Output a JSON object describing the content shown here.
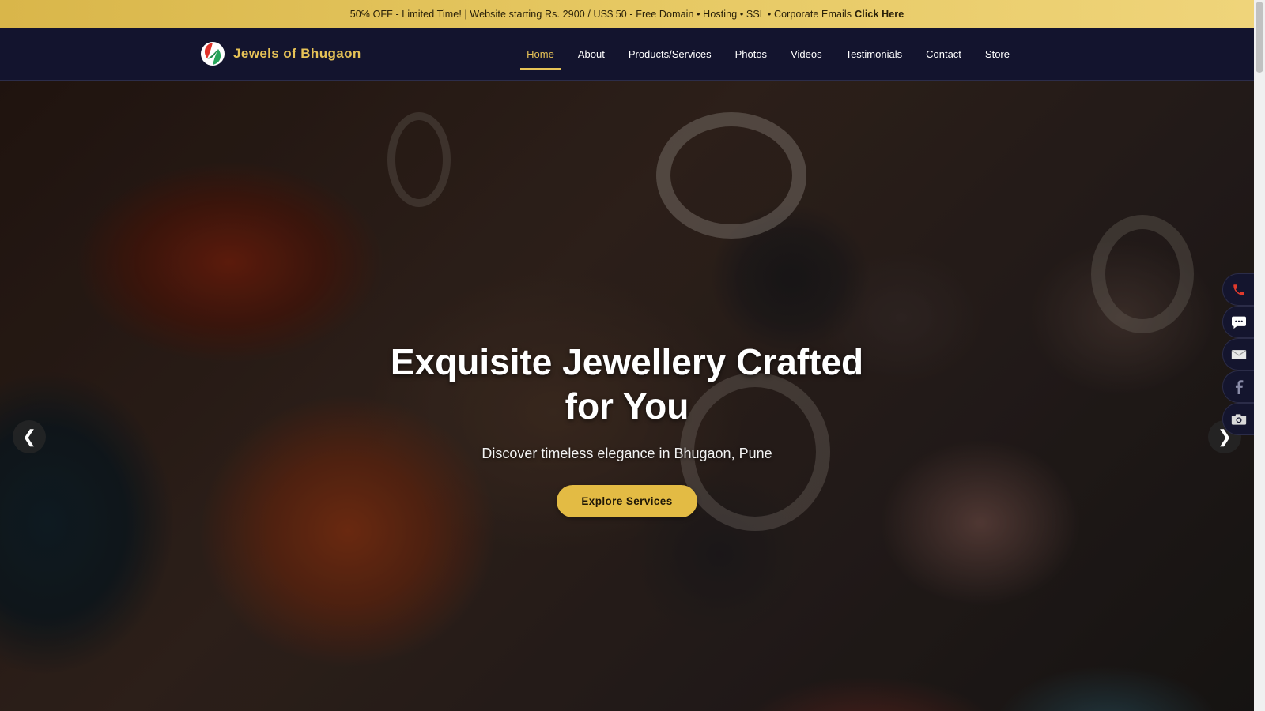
{
  "promo": {
    "text": "50% OFF - Limited Time! | Website starting Rs. 2900 / US$ 50 - Free Domain • Hosting • SSL • Corporate Emails",
    "cta": "Click Here"
  },
  "brand": {
    "name": "Jewels of Bhugaon",
    "logo_icon": "leaf-logo-icon"
  },
  "nav": {
    "items": [
      {
        "label": "Home",
        "active": true
      },
      {
        "label": "About",
        "active": false
      },
      {
        "label": "Products/Services",
        "active": false
      },
      {
        "label": "Photos",
        "active": false
      },
      {
        "label": "Videos",
        "active": false
      },
      {
        "label": "Testimonials",
        "active": false
      },
      {
        "label": "Contact",
        "active": false
      },
      {
        "label": "Store",
        "active": false
      }
    ]
  },
  "hero": {
    "title": "Exquisite Jewellery Crafted for You",
    "subtitle": "Discover timeless elegance in Bhugaon, Pune",
    "button": "Explore Services",
    "prev_arrow": "❮",
    "next_arrow": "❯"
  },
  "floating_actions": [
    "phone-icon",
    "chat-icon",
    "mail-icon",
    "facebook-icon",
    "instagram-icon"
  ],
  "colors": {
    "promo_bg": "#e6c862",
    "navbar_bg": "#13142e",
    "accent_gold": "#e6c257",
    "button_bg": "#e3bb44",
    "phone_red": "#e03a2c"
  }
}
